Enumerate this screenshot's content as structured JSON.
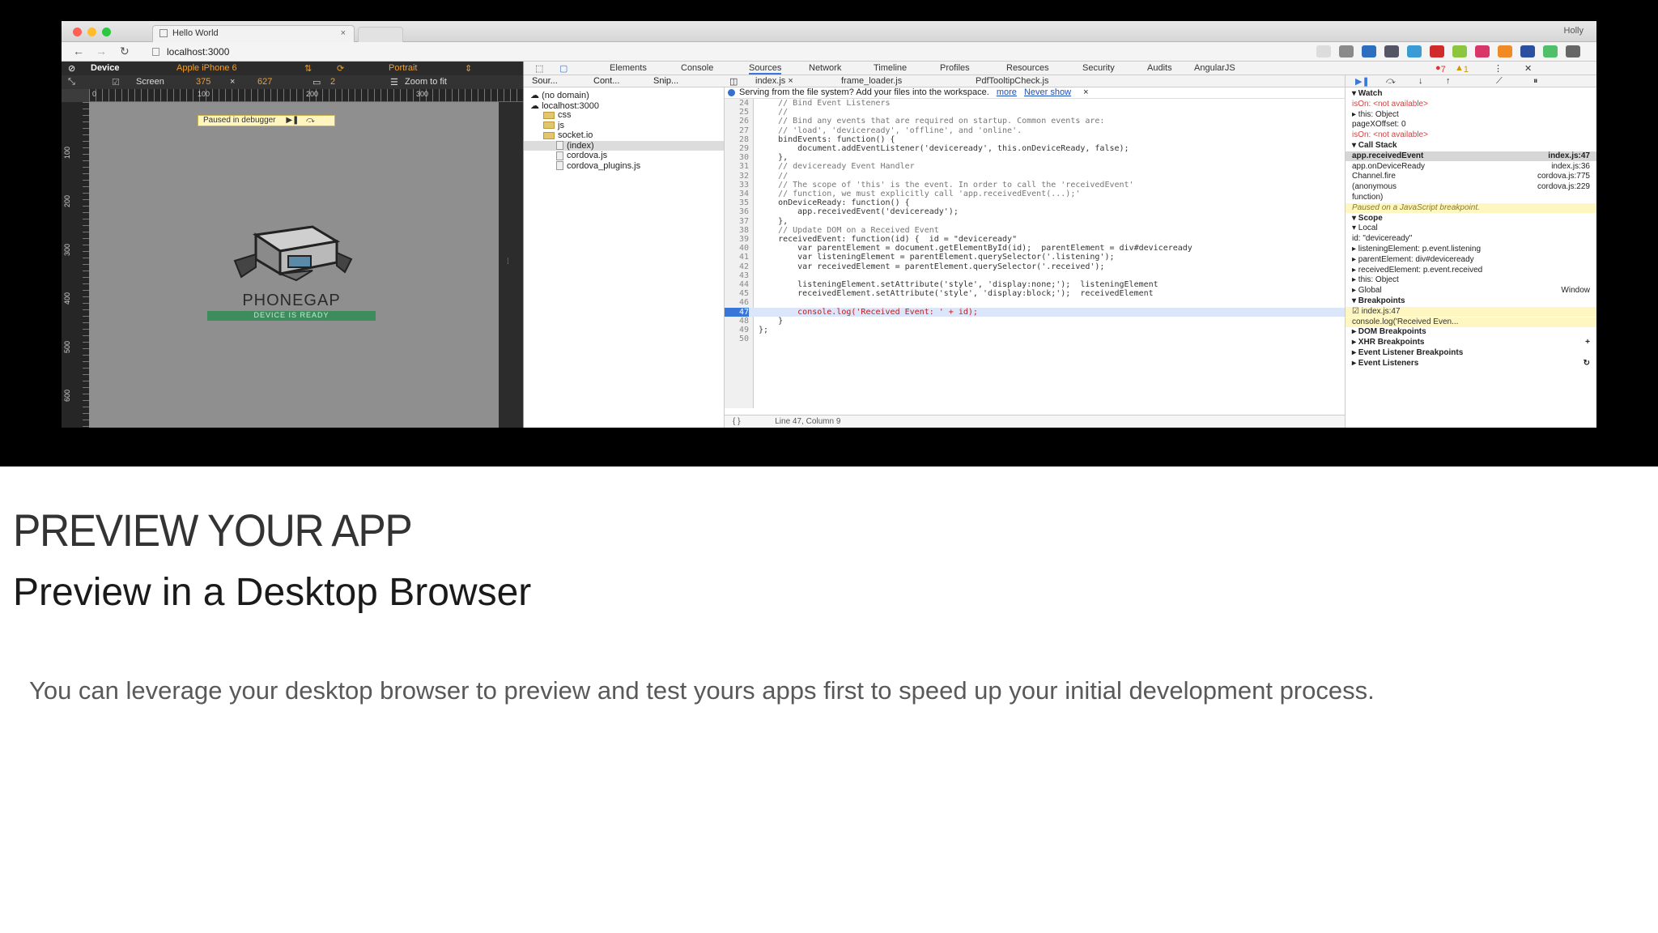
{
  "browser": {
    "tab_title": "Hello World",
    "tab_close": "×",
    "profile_name": "Holly",
    "address": "localhost:3000",
    "traffic_colors": [
      "#ff5f57",
      "#ffbd2e",
      "#28c940"
    ]
  },
  "device_toolbar": {
    "device_label": "Device",
    "device_value": "Apple iPhone 6",
    "orientation": "Portrait",
    "screen_label": "Screen",
    "width": "375",
    "times": "×",
    "height": "627",
    "dpr": "2",
    "zoom_label": "Zoom to fit",
    "ruler_ticks": [
      "0",
      "100",
      "200",
      "300"
    ],
    "ruler_vticks": [
      "100",
      "200",
      "300",
      "400",
      "500",
      "600"
    ]
  },
  "phone": {
    "paused_text": "Paused in debugger",
    "app_name": "PHONEGAP",
    "status": "DEVICE IS READY"
  },
  "devtools": {
    "tabs": [
      "Elements",
      "Console",
      "Sources",
      "Network",
      "Timeline",
      "Profiles",
      "Resources",
      "Security",
      "Audits",
      "AngularJS"
    ],
    "errors": "7",
    "warnings": "1",
    "navigator_tabs": [
      "Sour...",
      "Cont...",
      "Snip..."
    ],
    "tree": [
      {
        "label": "(no domain)",
        "kind": "cloud"
      },
      {
        "label": "localhost:3000",
        "kind": "cloud"
      },
      {
        "label": "css",
        "kind": "folder"
      },
      {
        "label": "js",
        "kind": "folder"
      },
      {
        "label": "socket.io",
        "kind": "folder"
      },
      {
        "label": "(index)",
        "kind": "file"
      },
      {
        "label": "cordova.js",
        "kind": "file"
      },
      {
        "label": "cordova_plugins.js",
        "kind": "file"
      }
    ],
    "file_tabs": [
      "index.js ×",
      "frame_loader.js",
      "PdfTooltipCheck.js"
    ],
    "info_text": "Serving from the file system? Add your files into the workspace.",
    "info_more": "more",
    "info_never": "Never show",
    "info_close": "×",
    "code": [
      {
        "n": "24",
        "t": "    // Bind Event Listeners",
        "c": true
      },
      {
        "n": "25",
        "t": "    //",
        "c": true
      },
      {
        "n": "26",
        "t": "    // Bind any events that are required on startup. Common events are:",
        "c": true
      },
      {
        "n": "27",
        "t": "    // 'load', 'deviceready', 'offline', and 'online'.",
        "c": true
      },
      {
        "n": "28",
        "t": "    bindEvents: function() {"
      },
      {
        "n": "29",
        "t": "        document.addEventListener('deviceready', this.onDeviceReady, false);"
      },
      {
        "n": "30",
        "t": "    },"
      },
      {
        "n": "31",
        "t": "    // deviceready Event Handler",
        "c": true
      },
      {
        "n": "32",
        "t": "    //",
        "c": true
      },
      {
        "n": "33",
        "t": "    // The scope of 'this' is the event. In order to call the 'receivedEvent'",
        "c": true
      },
      {
        "n": "34",
        "t": "    // function, we must explicitly call 'app.receivedEvent(...);'",
        "c": true
      },
      {
        "n": "35",
        "t": "    onDeviceReady: function() {"
      },
      {
        "n": "36",
        "t": "        app.receivedEvent('deviceready');"
      },
      {
        "n": "37",
        "t": "    },"
      },
      {
        "n": "38",
        "t": "    // Update DOM on a Received Event",
        "c": true
      },
      {
        "n": "39",
        "t": "    receivedEvent: function(id) {  id = \"deviceready\""
      },
      {
        "n": "40",
        "t": "        var parentElement = document.getElementById(id);  parentElement = div#deviceready"
      },
      {
        "n": "41",
        "t": "        var listeningElement = parentElement.querySelector('.listening');"
      },
      {
        "n": "42",
        "t": "        var receivedElement = parentElement.querySelector('.received');"
      },
      {
        "n": "43",
        "t": ""
      },
      {
        "n": "44",
        "t": "        listeningElement.setAttribute('style', 'display:none;');  listeningElement"
      },
      {
        "n": "45",
        "t": "        receivedElement.setAttribute('style', 'display:block;');  receivedElement"
      },
      {
        "n": "46",
        "t": ""
      },
      {
        "n": "47",
        "t": "        console.log('Received Event: ' + id);",
        "active": true
      },
      {
        "n": "48",
        "t": "    }"
      },
      {
        "n": "49",
        "t": "};"
      },
      {
        "n": "50",
        "t": ""
      }
    ],
    "status_bar": "Line 47, Column 9",
    "sidebar": [
      {
        "t": "▾ Watch",
        "k": "head"
      },
      {
        "t": "    isOn: <not available>",
        "k": "muted"
      },
      {
        "t": "  ▸ this: Object"
      },
      {
        "t": "    pageXOffset: 0"
      },
      {
        "t": "    isOn: <not available>",
        "k": "muted"
      },
      {
        "t": "▾ Call Stack",
        "k": "head"
      },
      {
        "t": "app.receivedEvent",
        "v": "index.js:47",
        "k": "sel"
      },
      {
        "t": "app.onDeviceReady",
        "v": "index.js:36"
      },
      {
        "t": "Channel.fire",
        "v": "cordova.js:775"
      },
      {
        "t": "(anonymous",
        "v": "cordova.js:229"
      },
      {
        "t": "function)"
      },
      {
        "t": "Paused on a JavaScript breakpoint.",
        "k": "yellow"
      },
      {
        "t": "▾ Scope",
        "k": "head"
      },
      {
        "t": "▾ Local"
      },
      {
        "t": "      id: \"deviceready\""
      },
      {
        "t": "    ▸ listeningElement: p.event.listening"
      },
      {
        "t": "    ▸ parentElement: div#deviceready"
      },
      {
        "t": "    ▸ receivedElement: p.event.received"
      },
      {
        "t": "    ▸ this: Object"
      },
      {
        "t": "▸ Global",
        "v": "Window"
      },
      {
        "t": "▾ Breakpoints",
        "k": "head"
      },
      {
        "t": "☑ index.js:47",
        "k": "yellowplain"
      },
      {
        "t": "      console.log('Received Even...",
        "k": "yellowplain"
      },
      {
        "t": "▸ DOM Breakpoints",
        "k": "head"
      },
      {
        "t": "▸ XHR Breakpoints",
        "k": "head",
        "v": "+"
      },
      {
        "t": "▸ Event Listener Breakpoints",
        "k": "head"
      },
      {
        "t": "▸ Event Listeners",
        "k": "head",
        "v": "↻"
      }
    ]
  },
  "section": {
    "title": "PREVIEW YOUR APP",
    "subtitle": "Preview in a Desktop Browser",
    "body": "You can leverage your desktop browser to preview and test yours apps first to speed up your initial development process."
  }
}
